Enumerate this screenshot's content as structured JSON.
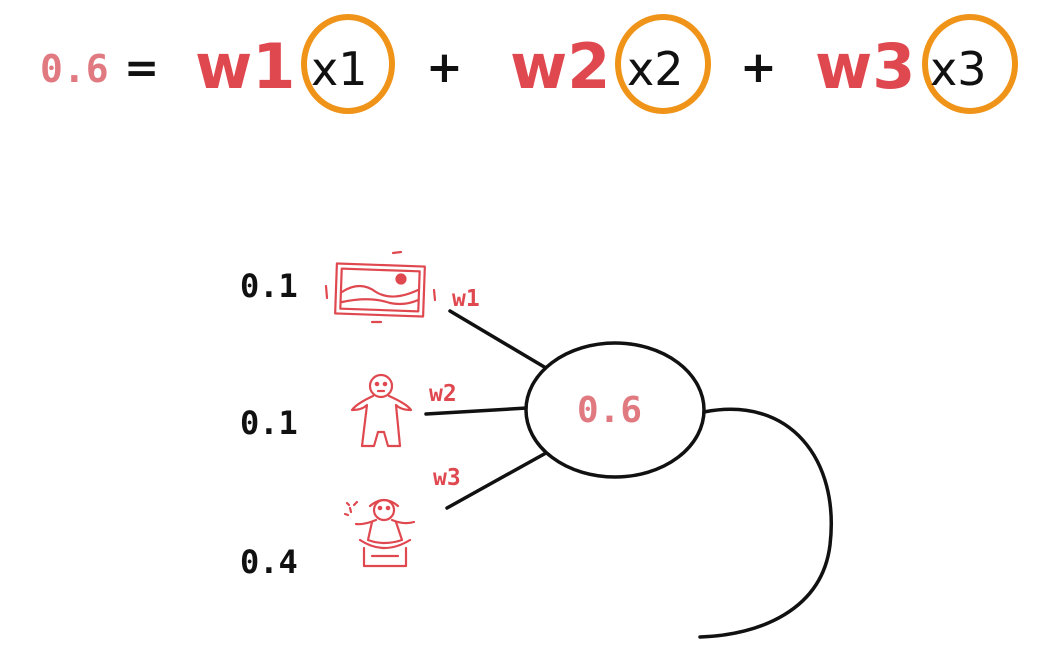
{
  "colors": {
    "red": "#e04850",
    "pink": "#e07a80",
    "orange": "#ef9418",
    "ink": "#111111"
  },
  "equation": {
    "result": "0.6",
    "equals": "=",
    "plus": "+",
    "terms": [
      {
        "weight": "w1",
        "input": "x1"
      },
      {
        "weight": "w2",
        "input": "x2"
      },
      {
        "weight": "w3",
        "input": "x3"
      }
    ]
  },
  "diagram": {
    "inputs": [
      {
        "value": "0.1",
        "weight": "w1",
        "icon": "landscape-picture-icon"
      },
      {
        "value": "0.1",
        "weight": "w2",
        "icon": "person-figure-icon"
      },
      {
        "value": "0.4",
        "weight": "w3",
        "icon": "girl-figure-icon"
      }
    ],
    "node_value": "0.6"
  }
}
